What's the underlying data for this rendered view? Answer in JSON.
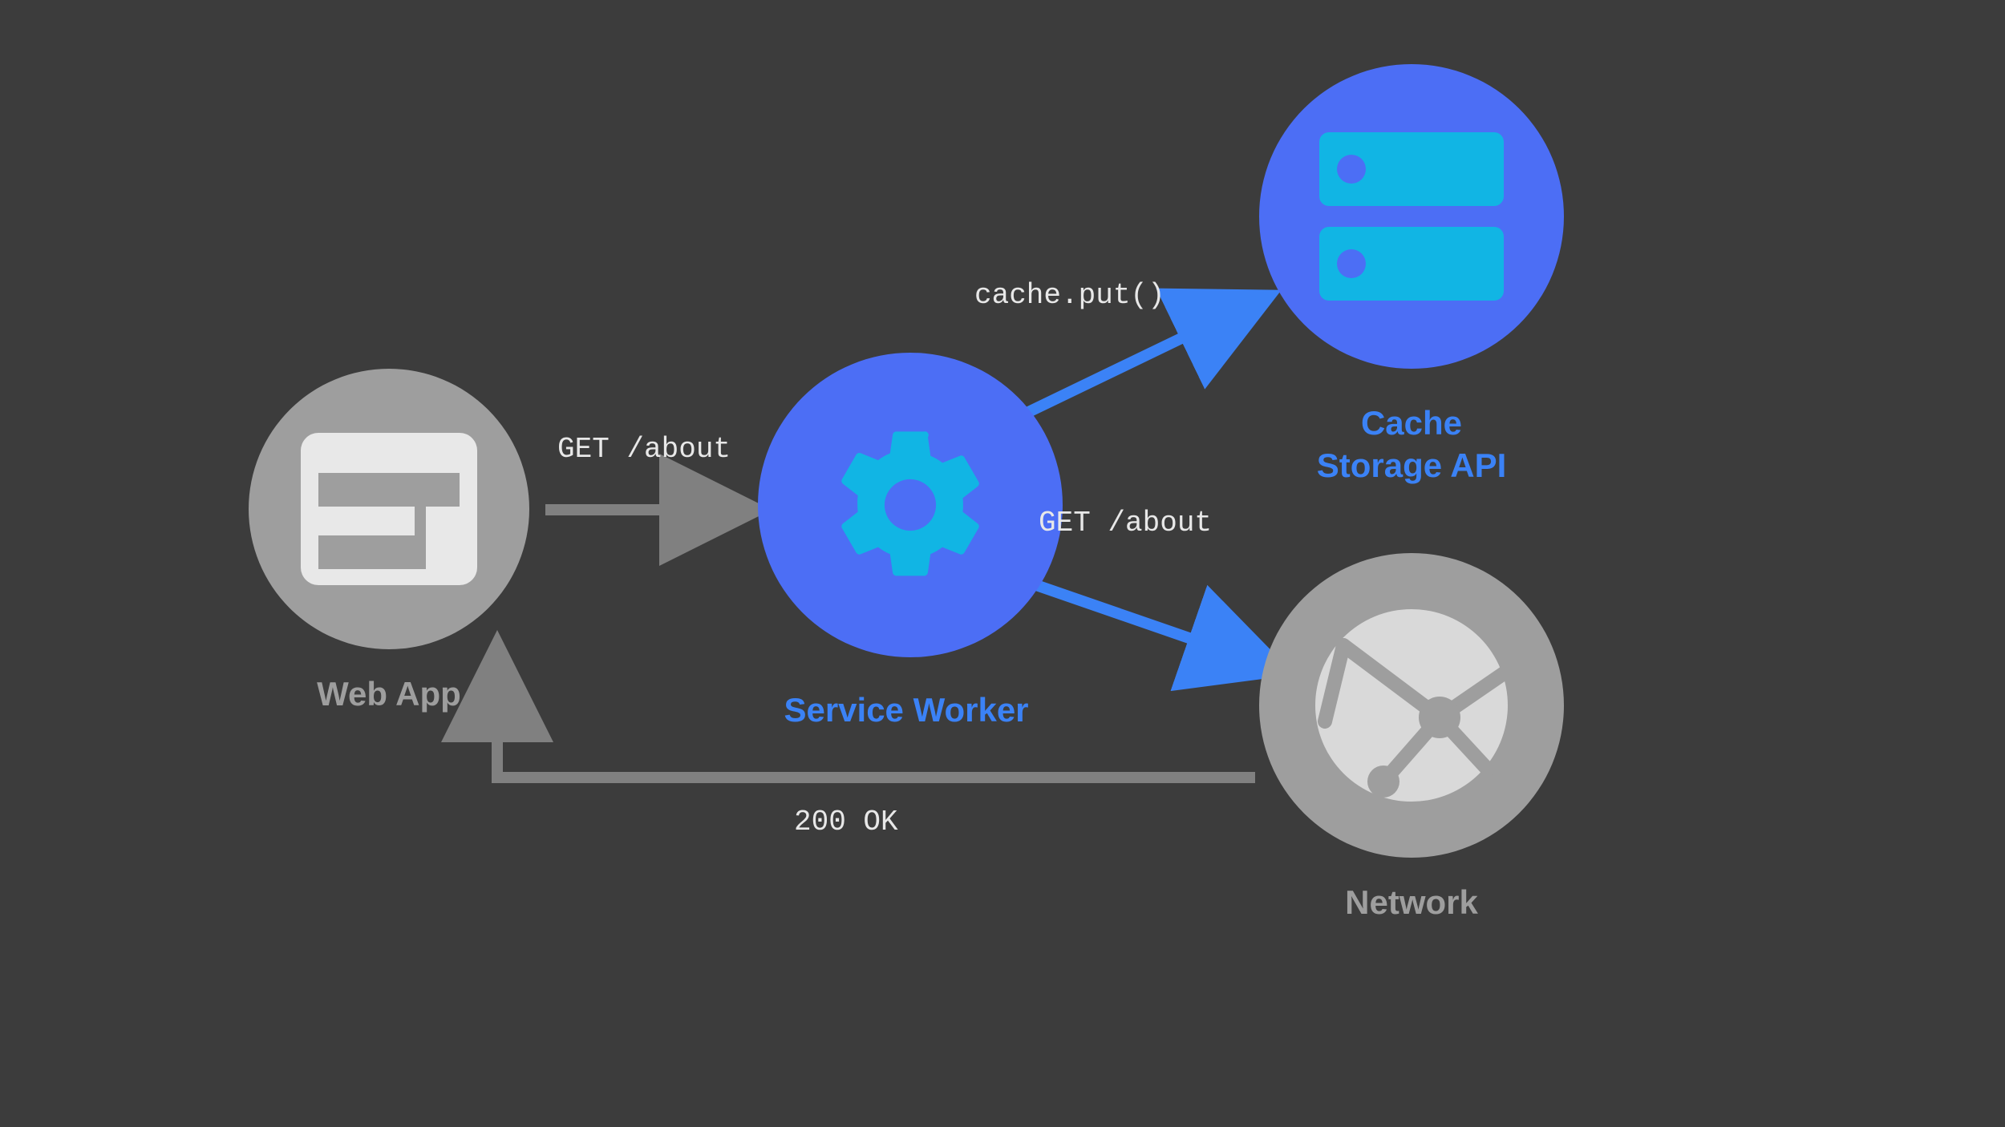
{
  "nodes": {
    "web_app": {
      "label": "Web App"
    },
    "service_worker": {
      "label": "Service Worker"
    },
    "cache_storage": {
      "label_line1": "Cache",
      "label_line2": "Storage API"
    },
    "network": {
      "label": "Network"
    }
  },
  "edges": {
    "web_to_sw": {
      "label": "GET /about"
    },
    "sw_to_cache": {
      "label": "cache.put()"
    },
    "sw_to_net": {
      "label": "GET /about"
    },
    "net_to_web": {
      "label": "200 OK"
    }
  },
  "colors": {
    "bg": "#3c3c3c",
    "gray": "#9e9e9e",
    "edge_gray": "#808080",
    "blue": "#4c6ef5",
    "blue_bright": "#3b82f6",
    "cyan": "#11b5e4",
    "white": "#e8e8e8",
    "offwhite": "#d9d9d9"
  }
}
